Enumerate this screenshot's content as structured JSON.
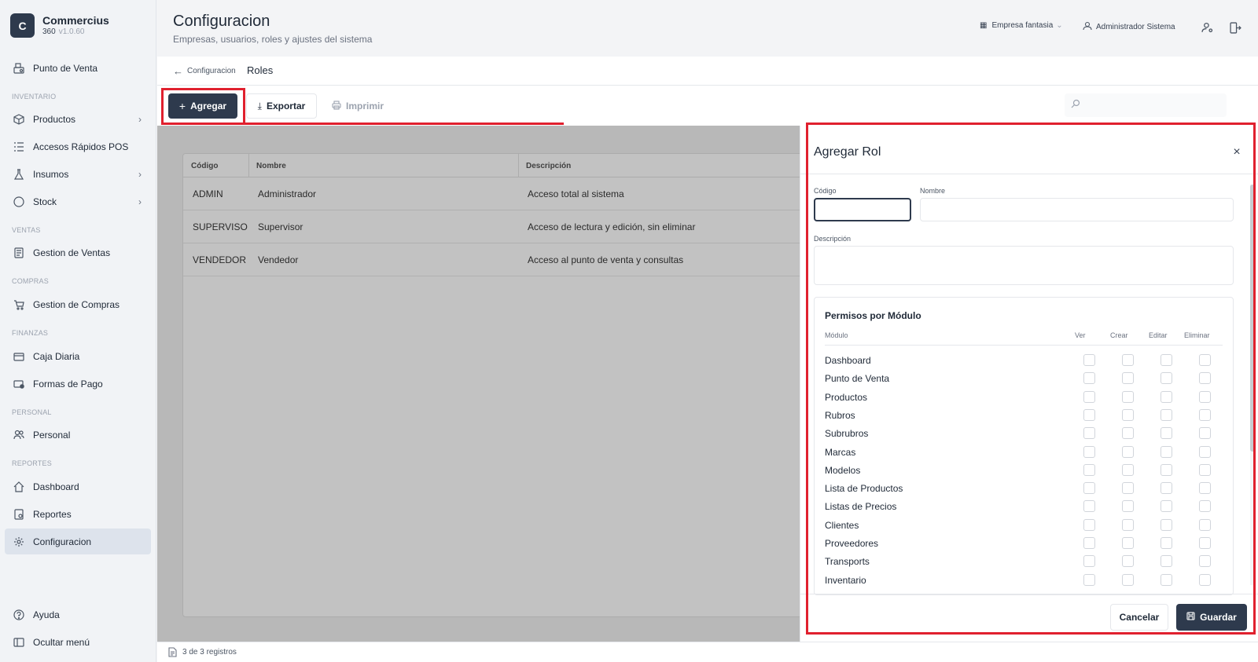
{
  "app": {
    "logo_letter": "C",
    "name": "Commercius",
    "edition": "360",
    "version": "v1.0.60"
  },
  "sidebar": {
    "top_item": "Punto de Venta",
    "sections": {
      "inventario": "INVENTARIO",
      "ventas": "VENTAS",
      "compras": "COMPRAS",
      "finanzas": "FINANZAS",
      "personal": "PERSONAL",
      "reportes": "REPORTES"
    },
    "items": {
      "productos": "Productos",
      "accesos": "Accesos Rápidos POS",
      "insumos": "Insumos",
      "stock": "Stock",
      "ventas": "Gestion de Ventas",
      "compras": "Gestion de Compras",
      "caja": "Caja Diaria",
      "formas": "Formas de Pago",
      "personal": "Personal",
      "dashboard": "Dashboard",
      "reportes": "Reportes",
      "configuracion": "Configuracion"
    },
    "footer": {
      "ayuda": "Ayuda",
      "ocultar": "Ocultar menú"
    }
  },
  "header": {
    "title": "Configuracion",
    "subtitle": "Empresas, usuarios, roles y ajustes del sistema",
    "company": "Empresa fantasia",
    "user": "Administrador Sistema"
  },
  "breadcrumb": {
    "back": "Configuracion",
    "current": "Roles"
  },
  "toolbar": {
    "add": "Agregar",
    "export": "Exportar",
    "print": "Imprimir",
    "search_placeholder": ""
  },
  "table": {
    "headers": {
      "code": "Código",
      "name": "Nombre",
      "desc": "Descripción"
    },
    "rows": [
      {
        "code": "ADMIN",
        "name": "Administrador",
        "desc": "Acceso total al sistema"
      },
      {
        "code": "SUPERVISO",
        "name": "Supervisor",
        "desc": "Acceso de lectura y edición, sin eliminar"
      },
      {
        "code": "VENDEDOR",
        "name": "Vendedor",
        "desc": "Acceso al punto de venta y consultas"
      }
    ]
  },
  "status": {
    "records": "3 de 3 registros"
  },
  "drawer": {
    "title": "Agregar Rol",
    "close": "×",
    "labels": {
      "code": "Código",
      "name": "Nombre",
      "desc": "Descripción"
    },
    "values": {
      "code": "",
      "name": "",
      "desc": ""
    },
    "permissions": {
      "title": "Permisos por Módulo",
      "headers": {
        "module": "Módulo",
        "ver": "Ver",
        "crear": "Crear",
        "editar": "Editar",
        "eliminar": "Eliminar"
      },
      "modules": [
        "Dashboard",
        "Punto de Venta",
        "Productos",
        "Rubros",
        "Subrubros",
        "Marcas",
        "Modelos",
        "Lista de Productos",
        "Listas de Precios",
        "Clientes",
        "Proveedores",
        "Transports",
        "Inventario"
      ]
    },
    "cancel": "Cancelar",
    "save": "Guardar"
  },
  "colors": {
    "primary": "#2e3a4d",
    "highlight": "#e0202e",
    "overlay": "#b8b8b8"
  }
}
